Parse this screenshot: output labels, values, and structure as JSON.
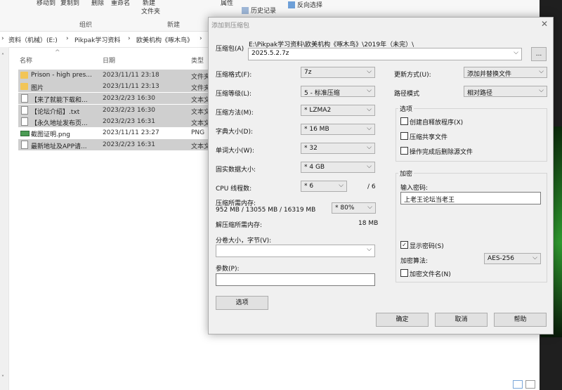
{
  "ribbon": {
    "buttons": [
      "移动到",
      "复制到",
      "删除",
      "重命名",
      "新建",
      "文件夹",
      "属性",
      "历史记录",
      "反向选择"
    ],
    "groups": [
      "组织",
      "新建"
    ]
  },
  "address": {
    "crumbs": [
      "资料（机械）(E:)",
      "Pikpak学习资料",
      "欧美机构《啄木鸟》"
    ]
  },
  "columns": {
    "name": "名称",
    "date": "日期",
    "type": "类型"
  },
  "files": [
    {
      "name": "Prison - high pres...",
      "date": "2023/11/11 23:18",
      "type": "文件夹",
      "kind": "folder"
    },
    {
      "name": "图片",
      "date": "2023/11/11 23:13",
      "type": "文件夹",
      "kind": "folder"
    },
    {
      "name": "【来了就能下载和...",
      "date": "2023/2/23 16:30",
      "type": "文本文",
      "kind": "doc"
    },
    {
      "name": "【论坛介绍】.txt",
      "date": "2023/2/23 16:30",
      "type": "文本文",
      "kind": "doc"
    },
    {
      "name": "【永久地址发布页...",
      "date": "2023/2/23 16:31",
      "type": "文本文",
      "kind": "doc"
    },
    {
      "name": "截图证明.png",
      "date": "2023/11/11 23:27",
      "type": "PNG",
      "kind": "png"
    },
    {
      "name": "最新地址及APP请...",
      "date": "2023/2/23 16:31",
      "type": "文本文",
      "kind": "doc"
    }
  ],
  "dialog": {
    "title": "添加到压缩包",
    "archive_label": "压缩包(A)",
    "archive_path": "E:\\Pikpak学习资料\\欧美机构《啄木鸟》\\2019年（未完）\\",
    "archive_name": "2025.5.2.7z",
    "browse_label": "...",
    "format_label": "压缩格式(F):",
    "format_value": "7z",
    "level_label": "压缩等级(L):",
    "level_value": "5 - 标准压缩",
    "method_label": "压缩方法(M):",
    "method_value": "* LZMA2",
    "dict_label": "字典大小(D):",
    "dict_value": "* 16 MB",
    "word_label": "单词大小(W):",
    "word_value": "* 32",
    "solid_label": "固实数据大小:",
    "solid_value": "* 4 GB",
    "cpu_label": "CPU 线程数:",
    "cpu_value": "* 6",
    "cpu_total": "/ 6",
    "mem_label": "压缩所需内存:",
    "mem_detail": "952 MB / 13055 MB / 16319 MB",
    "mem_value": "* 80%",
    "decomp_label": "解压缩所需内存:",
    "decomp_value": "18 MB",
    "split_label": "分卷大小，字节(V):",
    "split_value": "",
    "params_label": "参数(P):",
    "params_value": "",
    "options_button": "选项",
    "update_label": "更新方式(U):",
    "update_value": "添加并替换文件",
    "path_label": "路径模式",
    "path_value": "相对路径",
    "options_group": "选项",
    "opt_sfx": "创建自释放程序(X)",
    "opt_shared": "压缩共享文件",
    "opt_delete": "操作完成后删除源文件",
    "enc_group": "加密",
    "password_label": "输入密码:",
    "password_value": "上老王论坛当老王",
    "show_password": "显示密码(S)",
    "enc_method_label": "加密算法:",
    "enc_method_value": "AES-256",
    "enc_names": "加密文件名(N)",
    "ok": "确定",
    "cancel": "取消",
    "help": "帮助"
  }
}
